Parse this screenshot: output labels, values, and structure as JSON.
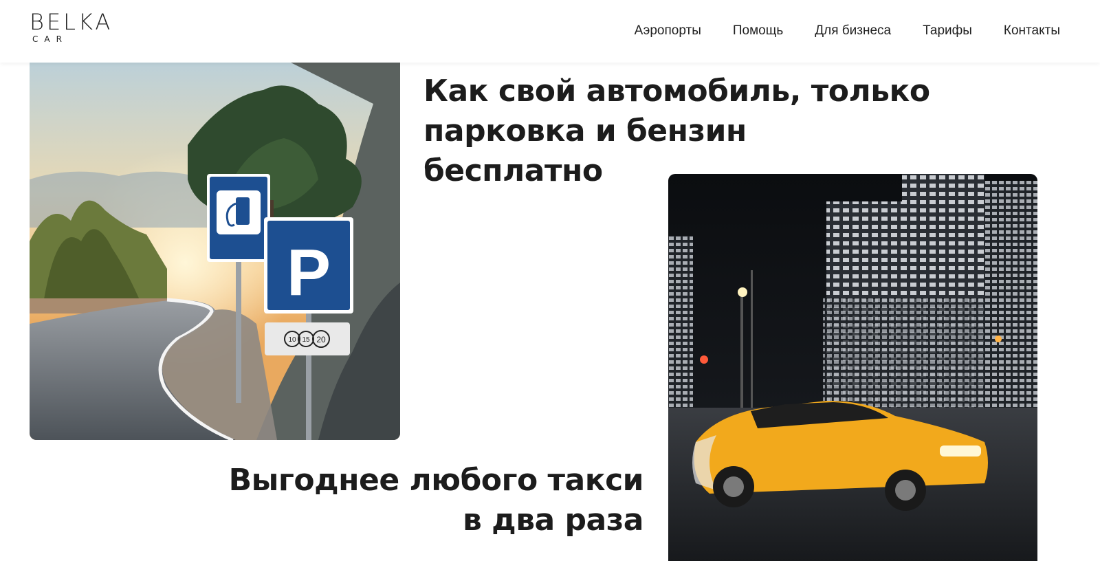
{
  "header": {
    "logo_main": "BELKA",
    "logo_sub": "CAR",
    "nav": [
      "Аэропорты",
      "Помощь",
      "Для бизнеса",
      "Тарифы",
      "Контакты"
    ]
  },
  "hero": {
    "heading1_lines": [
      "Как свой автомобиль, только",
      "парковка и бензин бесплатно"
    ],
    "heading2_lines": [
      "Выгоднее любого такси",
      "в два раза"
    ]
  },
  "images": {
    "road": {
      "description_icon": "road-signs-image",
      "sign_parking_letter": "P",
      "sign_times": [
        "10",
        "15",
        "20"
      ]
    },
    "city": {
      "description_icon": "night-city-taxi-image"
    }
  },
  "colors": {
    "text": "#1c1c1c",
    "sign_blue": "#1d4f91",
    "taxi_yellow": "#f2a91c"
  }
}
